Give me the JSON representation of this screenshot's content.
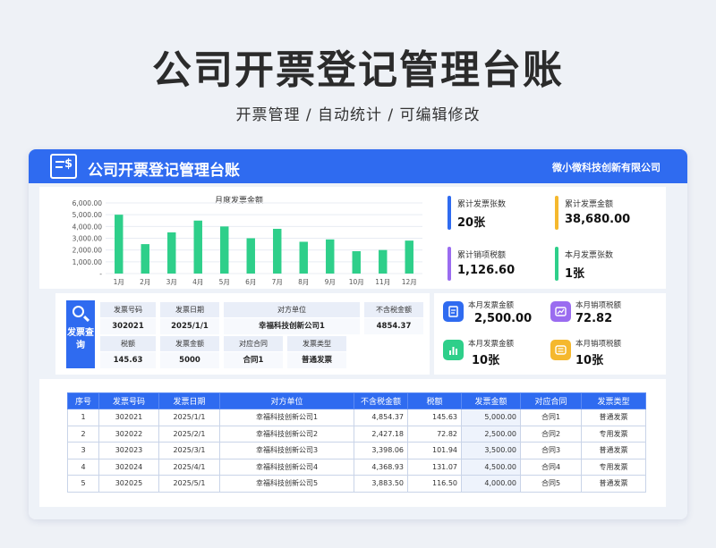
{
  "page": {
    "title": "公司开票登记管理台账",
    "subtitle": "开票管理 /  自动统计  /  可编辑修改"
  },
  "header": {
    "title": "公司开票登记管理台账",
    "company": "微小微科技创新有限公司"
  },
  "chart_data": {
    "type": "bar",
    "title": "月度发票金额",
    "categories": [
      "1月",
      "2月",
      "3月",
      "4月",
      "5月",
      "6月",
      "7月",
      "8月",
      "9月",
      "10月",
      "11月",
      "12月"
    ],
    "values": [
      5000,
      2500,
      3500,
      4500,
      4000,
      3000,
      3800,
      2700,
      2900,
      1900,
      2000,
      2800
    ],
    "yticks": [
      "6,000.00",
      "5,000.00",
      "4,000.00",
      "3,000.00",
      "2,000.00",
      "1,000.00",
      "-"
    ],
    "ylim": [
      0,
      6000
    ],
    "color": "#2ecf8a"
  },
  "stats": {
    "total_count_label": "累计发票张数",
    "total_count_value": "20张",
    "total_amount_label": "累计发票金额",
    "total_amount_value": "38,680.00",
    "total_tax_label": "累计销项税额",
    "total_tax_value": "1,126.60",
    "month_count_label": "本月发票张数",
    "month_count_value": "1张"
  },
  "query": {
    "badge": "发票查询",
    "row1_headers": [
      "发票号码",
      "发票日期",
      "对方单位",
      "不含税金额"
    ],
    "row1_values": [
      "302021",
      "2025/1/1",
      "幸福科技创新公司1",
      "4854.37"
    ],
    "row2_headers": [
      "税额",
      "发票金额",
      "对应合同",
      "发票类型"
    ],
    "row2_values": [
      "145.63",
      "5000",
      "合同1",
      "普通发票"
    ]
  },
  "monthly": {
    "amount_label": "本月发票金额",
    "amount_value": "2,500.00",
    "tax_label": "本月销项税额",
    "tax_value": "72.82",
    "amount_count_label": "本月发票金额",
    "amount_count_value": "10张",
    "tax_count_label": "本月销项税额",
    "tax_count_value": "10张"
  },
  "colors": {
    "primary": "#2f6bf0",
    "green": "#2ecf8a",
    "yellow": "#f5b82e",
    "purple": "#9a6cf0"
  },
  "table": {
    "headers": [
      "序号",
      "发票号码",
      "发票日期",
      "对方单位",
      "不含税金额",
      "税额",
      "发票金额",
      "对应合同",
      "发票类型"
    ],
    "rows": [
      [
        "1",
        "302021",
        "2025/1/1",
        "幸福科技创新公司1",
        "4,854.37",
        "145.63",
        "5,000.00",
        "合同1",
        "普通发票"
      ],
      [
        "2",
        "302022",
        "2025/2/1",
        "幸福科技创新公司2",
        "2,427.18",
        "72.82",
        "2,500.00",
        "合同2",
        "专用发票"
      ],
      [
        "3",
        "302023",
        "2025/3/1",
        "幸福科技创新公司3",
        "3,398.06",
        "101.94",
        "3,500.00",
        "合同3",
        "普通发票"
      ],
      [
        "4",
        "302024",
        "2025/4/1",
        "幸福科技创新公司4",
        "4,368.93",
        "131.07",
        "4,500.00",
        "合同4",
        "专用发票"
      ],
      [
        "5",
        "302025",
        "2025/5/1",
        "幸福科技创新公司5",
        "3,883.50",
        "116.50",
        "4,000.00",
        "合同5",
        "普通发票"
      ]
    ]
  }
}
